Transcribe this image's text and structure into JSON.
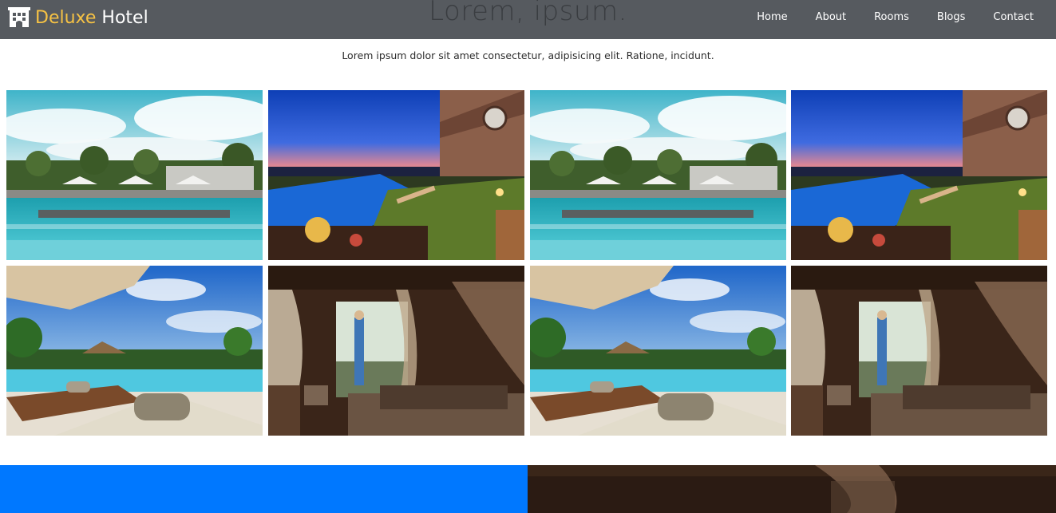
{
  "navbar": {
    "brand_first": "Deluxe",
    "brand_second": " Hotel",
    "brand_icon": "hotel-building-icon",
    "hero_title": "Lorem, ipsum.",
    "links": [
      {
        "label": "Home"
      },
      {
        "label": "About"
      },
      {
        "label": "Rooms"
      },
      {
        "label": "Blogs"
      },
      {
        "label": "Contact"
      }
    ]
  },
  "subtitle": "Lorem ipsum dolor sit amet consectetur, adipisicing elit. Ratione, incidunt.",
  "gallery": {
    "photos": [
      {
        "subject": "resort-pool-daytime"
      },
      {
        "subject": "pool-terrace-dusk"
      },
      {
        "subject": "resort-pool-daytime"
      },
      {
        "subject": "pool-terrace-dusk"
      },
      {
        "subject": "tropical-pool-loungers"
      },
      {
        "subject": "canopy-bedroom-balcony"
      },
      {
        "subject": "tropical-pool-loungers"
      },
      {
        "subject": "canopy-bedroom-balcony"
      }
    ]
  },
  "colors": {
    "navbar": "#565a5f",
    "brand_accent": "#f6c244",
    "bottom_panel": "#0078ff"
  }
}
